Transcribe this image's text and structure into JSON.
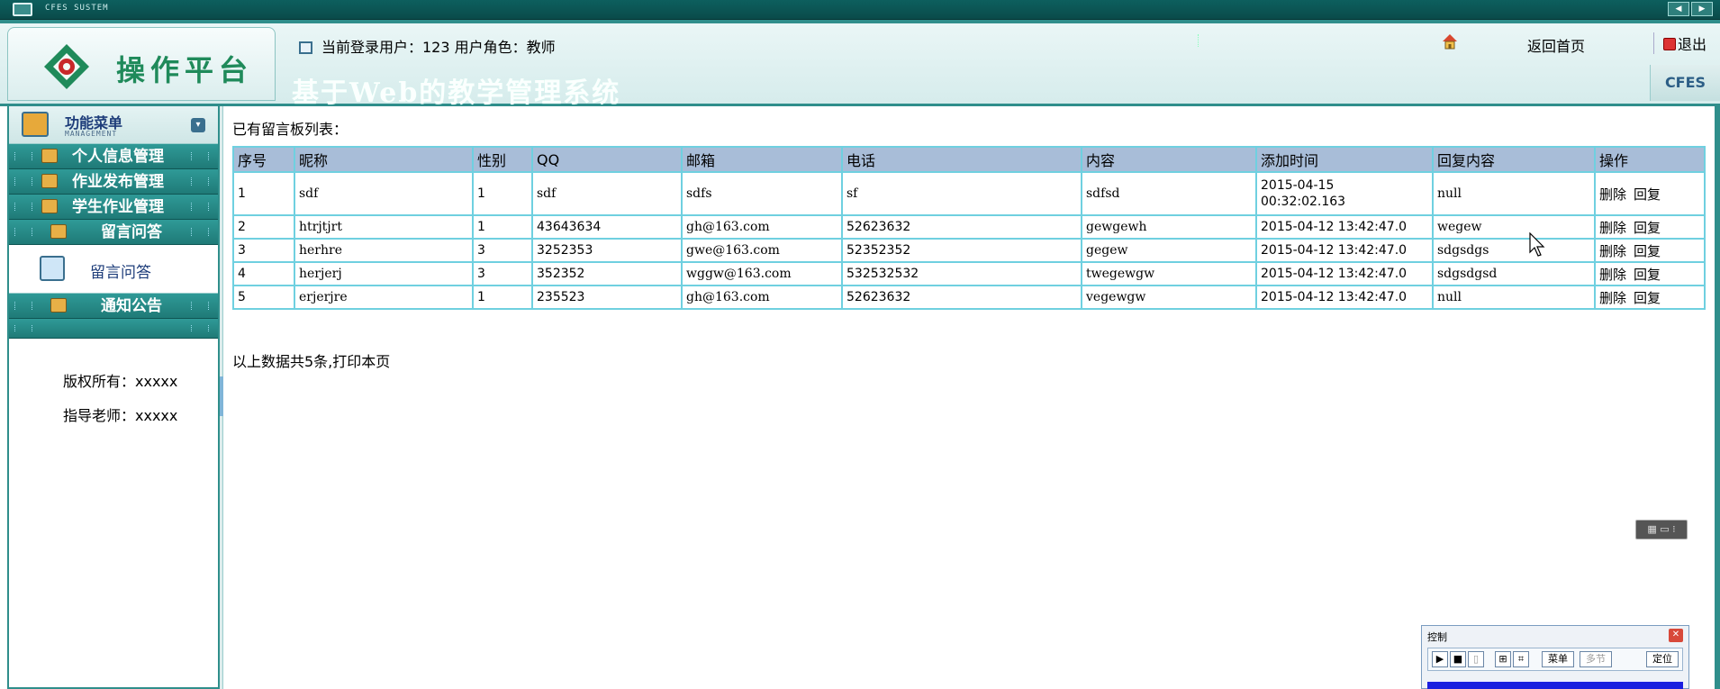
{
  "system": {
    "title": "CFES SUSTEM"
  },
  "header": {
    "logo_text": "操作平台",
    "user_info": "当前登录用户：123   用户角色：教师",
    "home_link": "返回首页",
    "exit_link": "退出",
    "system_title": "基于Web的教学管理系统",
    "brand_tag": "CFES"
  },
  "sidebar": {
    "menu_title": "功能菜单",
    "menu_subtitle": "MANAGEMENT",
    "items": [
      {
        "label": "个人信息管理"
      },
      {
        "label": "作业发布管理"
      },
      {
        "label": "学生作业管理"
      },
      {
        "label": "留言问答"
      },
      {
        "label": "通知公告"
      }
    ],
    "submenu": {
      "label": "留言问答"
    },
    "copyright": "版权所有：xxxxx",
    "advisor": "指导老师：xxxxx"
  },
  "main": {
    "list_title": "已有留言板列表：",
    "columns": [
      "序号",
      "昵称",
      "性别",
      "QQ",
      "邮箱",
      "电话",
      "内容",
      "添加时间",
      "回复内容",
      "操作"
    ],
    "rows": [
      {
        "no": "1",
        "nickname": "sdf",
        "gender": "1",
        "qq": "sdf",
        "email": "sdfs",
        "phone": "sf",
        "content": "sdfsd",
        "time_line1": "2015-04-15",
        "time_line2": "00:32:02.163",
        "reply": "null"
      },
      {
        "no": "2",
        "nickname": "htrjtjrt",
        "gender": "1",
        "qq": "43643634",
        "email": "gh@163.com",
        "phone": "52623632",
        "content": "gewgewh",
        "time": "2015-04-12 13:42:47.0",
        "reply": "wegew"
      },
      {
        "no": "3",
        "nickname": "herhre",
        "gender": "3",
        "qq": "3252353",
        "email": "gwe@163.com",
        "phone": "52352352",
        "content": "gegew",
        "time": "2015-04-12 13:42:47.0",
        "reply": "sdgsdgs"
      },
      {
        "no": "4",
        "nickname": "herjerj",
        "gender": "3",
        "qq": "352352",
        "email": "wggw@163.com",
        "phone": "532532532",
        "content": "twegewgw",
        "time": "2015-04-12 13:42:47.0",
        "reply": "sdgsdgsd"
      },
      {
        "no": "5",
        "nickname": "erjerjre",
        "gender": "1",
        "qq": "235523",
        "email": "gh@163.com",
        "phone": "52623632",
        "content": "vegewgw",
        "time": "2015-04-12 13:42:47.0",
        "reply": "null"
      }
    ],
    "actions": {
      "delete": "删除",
      "reply": "回复"
    },
    "summary": "以上数据共5条,打印本页"
  },
  "control_panel": {
    "title": "控制",
    "menu_btn": "菜单",
    "multi_btn": "多节",
    "locate_btn": "定位"
  },
  "colors": {
    "teal": "#2f8e8b",
    "table_header": "#a8bdd8",
    "table_border": "#6fd0e0"
  }
}
